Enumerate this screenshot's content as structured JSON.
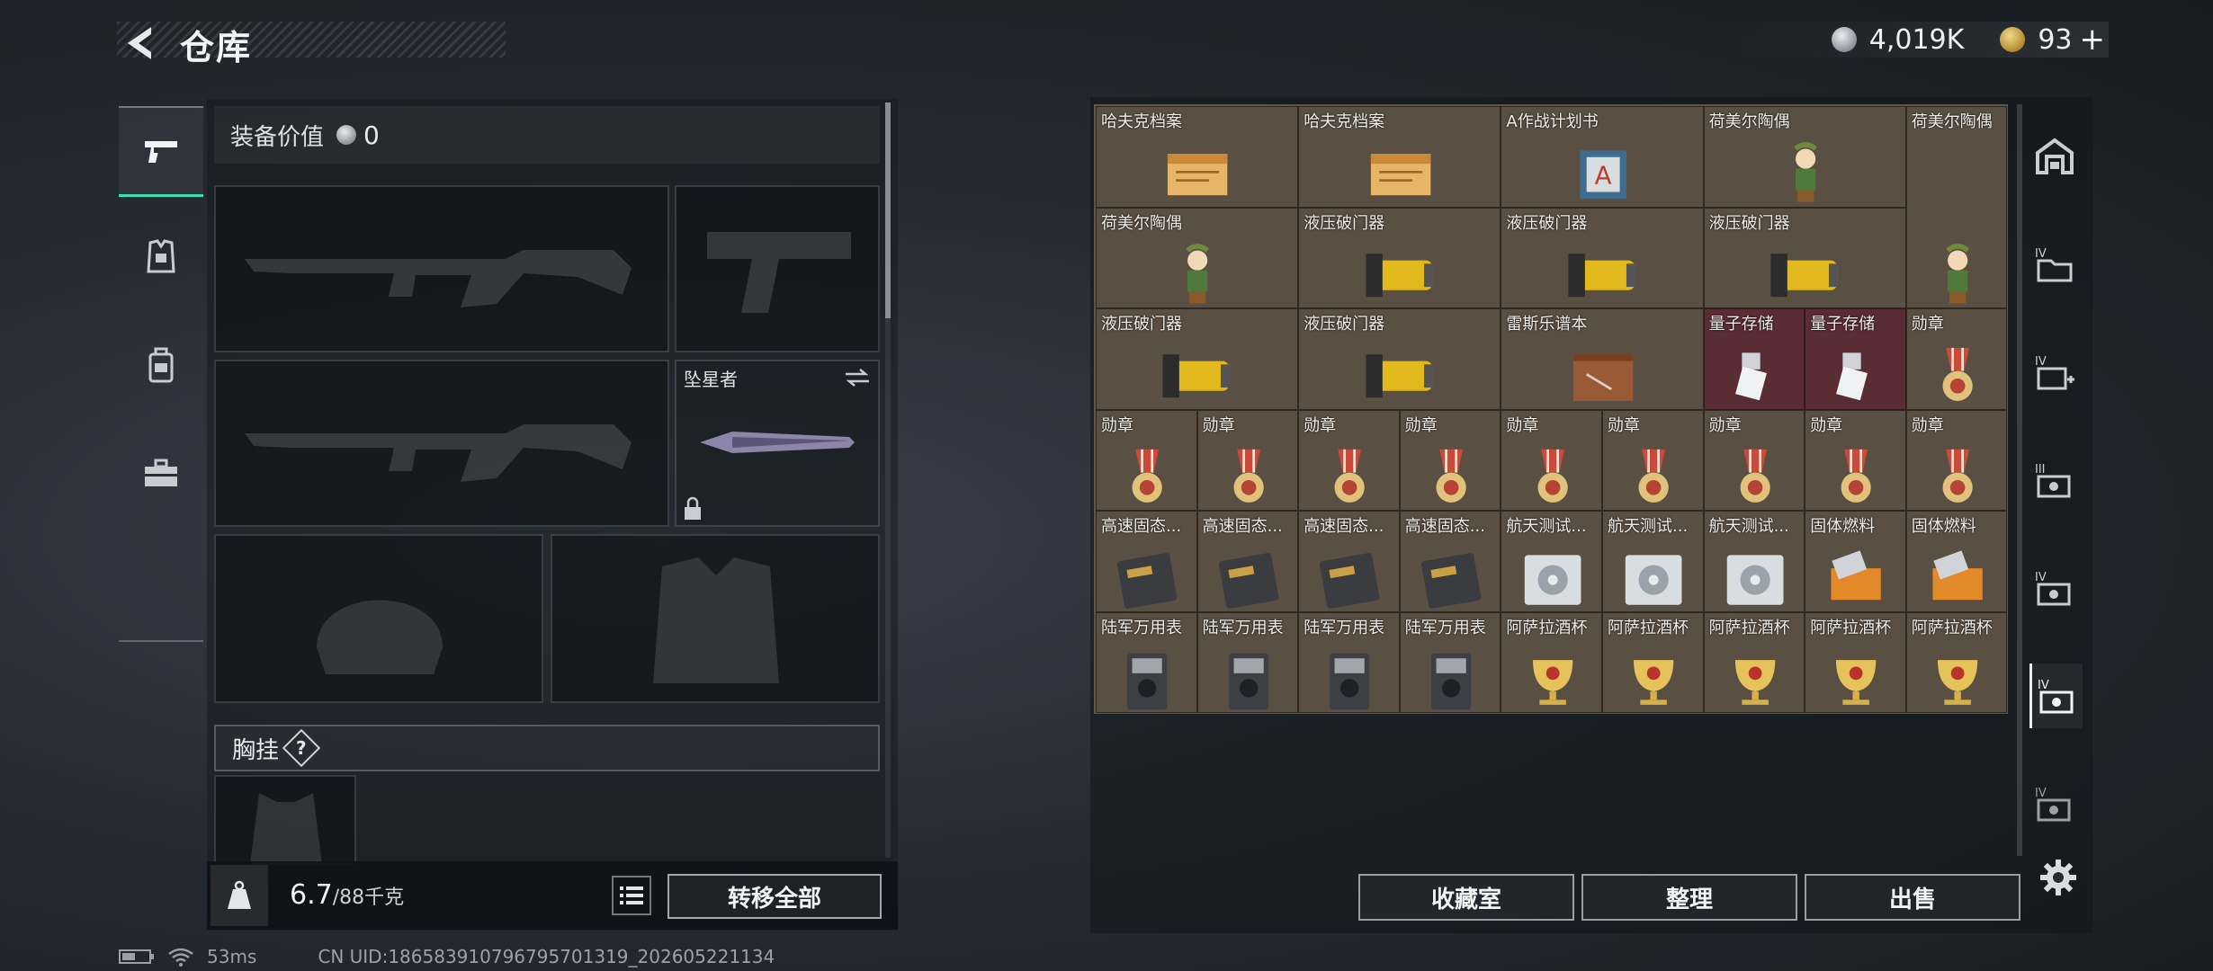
{
  "header": {
    "title": "仓库",
    "coins": "4,019K",
    "tickets": "93"
  },
  "loadout": {
    "equip_value_label": "装备价值",
    "equip_value": "0",
    "melee_name": "坠星者",
    "chest_label": "胸挂",
    "help": "?",
    "weight_current": "6.7",
    "weight_max": "/88千克",
    "transfer_all": "转移全部"
  },
  "stash": {
    "items": [
      {
        "name": "哈夫克档案",
        "icon": "file-icon"
      },
      {
        "name": "哈夫克档案",
        "icon": "file-icon"
      },
      {
        "name": "A作战计划书",
        "icon": "plan-icon"
      },
      {
        "name": "荷美尔陶偶",
        "icon": "figurine-icon"
      },
      {
        "name": "荷美尔陶偶",
        "icon": "figurine-icon"
      },
      {
        "name": "荷美尔陶偶",
        "icon": "figurine-icon"
      },
      {
        "name": "液压破门器",
        "icon": "breacher-icon"
      },
      {
        "name": "液压破门器",
        "icon": "breacher-icon"
      },
      {
        "name": "液压破门器",
        "icon": "breacher-icon"
      },
      {
        "name": "液压破门器",
        "icon": "breacher-icon"
      },
      {
        "name": "液压破门器",
        "icon": "breacher-icon"
      },
      {
        "name": "雷斯乐谱本",
        "icon": "score-icon"
      },
      {
        "name": "量子存储",
        "icon": "usb-icon"
      },
      {
        "name": "量子存储",
        "icon": "usb-icon"
      },
      {
        "name": "勋章",
        "icon": "medal-icon"
      },
      {
        "name": "勋章",
        "icon": "medal-icon"
      },
      {
        "name": "勋章",
        "icon": "medal-icon"
      },
      {
        "name": "勋章",
        "icon": "medal-icon"
      },
      {
        "name": "勋章",
        "icon": "medal-icon"
      },
      {
        "name": "勋章",
        "icon": "medal-icon"
      },
      {
        "name": "勋章",
        "icon": "medal-icon"
      },
      {
        "name": "勋章",
        "icon": "medal-icon"
      },
      {
        "name": "勋章",
        "icon": "medal-icon"
      },
      {
        "name": "勋章",
        "icon": "medal-icon"
      },
      {
        "name": "高速固态...",
        "icon": "ssd-icon"
      },
      {
        "name": "高速固态...",
        "icon": "ssd-icon"
      },
      {
        "name": "高速固态...",
        "icon": "ssd-icon"
      },
      {
        "name": "高速固态...",
        "icon": "ssd-icon"
      },
      {
        "name": "航天测试...",
        "icon": "disk-icon"
      },
      {
        "name": "航天测试...",
        "icon": "disk-icon"
      },
      {
        "name": "航天测试...",
        "icon": "disk-icon"
      },
      {
        "name": "固体燃料",
        "icon": "fuel-icon"
      },
      {
        "name": "固体燃料",
        "icon": "fuel-icon"
      },
      {
        "name": "陆军万用表",
        "icon": "multimeter-icon"
      },
      {
        "name": "陆军万用表",
        "icon": "multimeter-icon"
      },
      {
        "name": "陆军万用表",
        "icon": "multimeter-icon"
      },
      {
        "name": "陆军万用表",
        "icon": "multimeter-icon"
      },
      {
        "name": "阿萨拉酒杯",
        "icon": "goblet-icon"
      },
      {
        "name": "阿萨拉酒杯",
        "icon": "goblet-icon"
      },
      {
        "name": "阿萨拉酒杯",
        "icon": "goblet-icon"
      },
      {
        "name": "阿萨拉酒杯",
        "icon": "goblet-icon"
      },
      {
        "name": "阿萨拉酒杯",
        "icon": "goblet-icon"
      }
    ],
    "buttons": {
      "collection": "收藏室",
      "sort": "整理",
      "sell": "出售"
    }
  },
  "status": {
    "ping": "53ms",
    "uid": "CN UID:186583910796795701319_202605221134"
  }
}
